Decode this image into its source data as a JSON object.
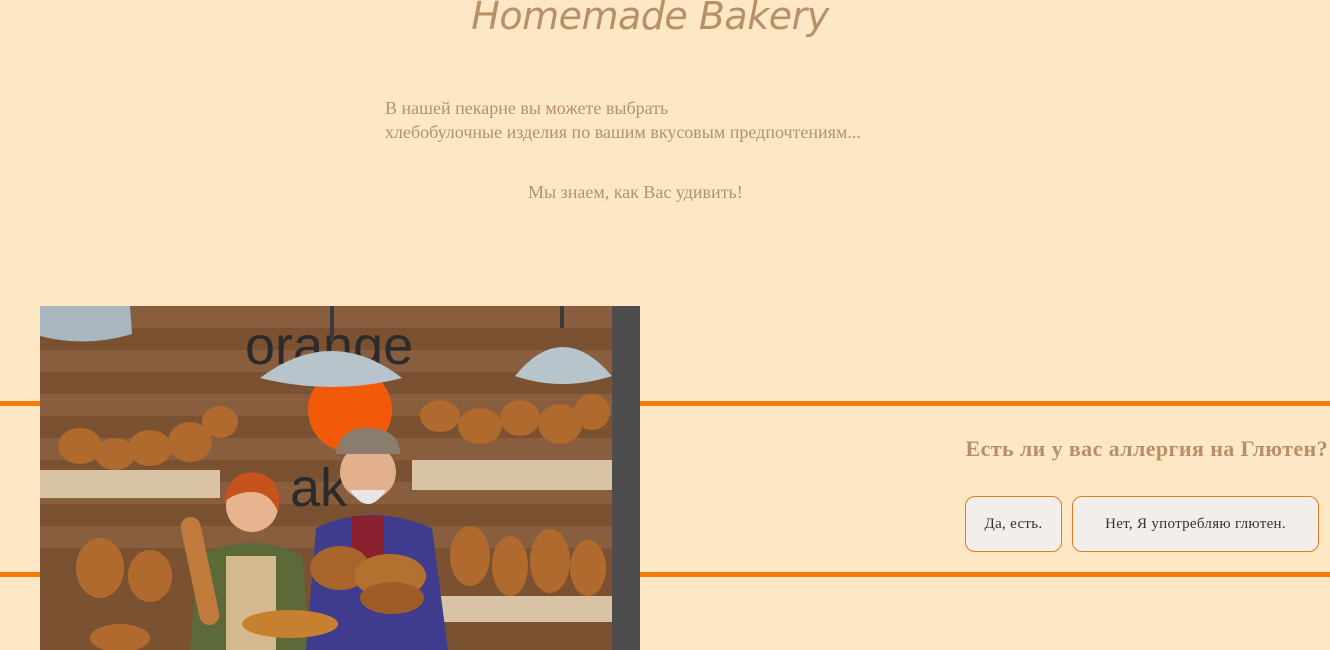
{
  "header": {
    "title": "Homemade Bakery"
  },
  "intro": {
    "line1": "В нашей пекарне вы можете выбрать",
    "line2": "хлебобулочные изделия по вашим вкусовым предпочтениям..."
  },
  "tagline": "Мы знаем, как Вас удивить!",
  "photo": {
    "sign_text": "orange bakery"
  },
  "quiz": {
    "question": "Есть ли у вас аллергия на Глютен?",
    "yes_label": "Да, есть.",
    "no_label": "Нет, Я употребляю глютен."
  },
  "colors": {
    "background": "#fde7c4",
    "accent": "#f07c0a",
    "text": "#b89068"
  }
}
